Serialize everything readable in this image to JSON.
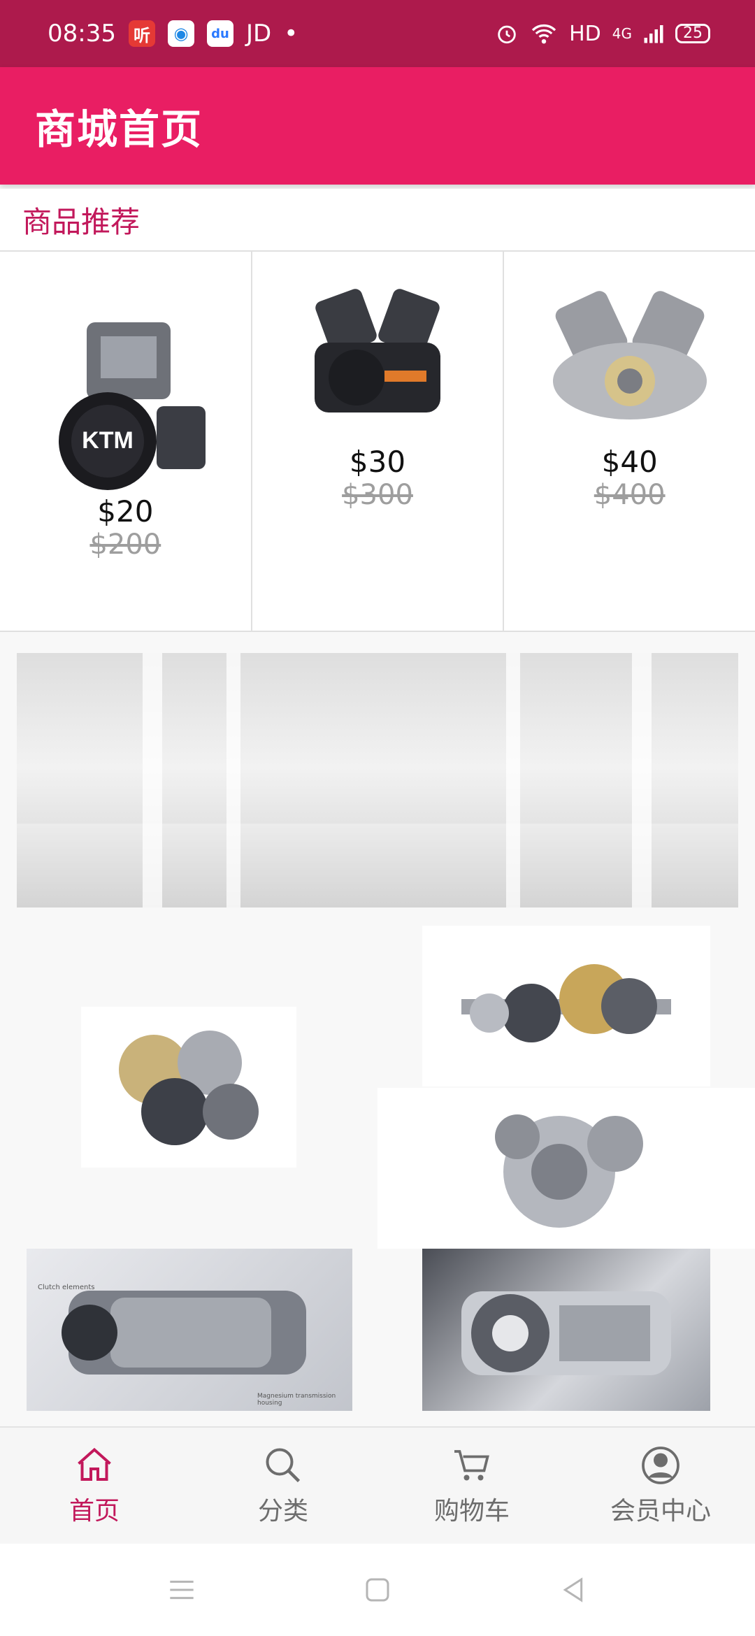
{
  "status_bar": {
    "time": "08:35",
    "app_icons": [
      {
        "icon": "ting-app-icon",
        "glyph": "听",
        "color": "#e53935"
      },
      {
        "icon": "browser-app-icon",
        "glyph": "◉",
        "color": "#1e88e5"
      },
      {
        "icon": "baidu-app-icon",
        "glyph": "du",
        "color": "#2979ff"
      }
    ],
    "jd_label": "JD",
    "dot": "•",
    "network": "HD",
    "signal_type": "4G",
    "battery": "25"
  },
  "app_bar": {
    "title": "商城首页"
  },
  "section": {
    "title": "商品推荐"
  },
  "products": [
    {
      "image_icon": "ktm-engine-image",
      "price": "$20",
      "original_price": "$200"
    },
    {
      "image_icon": "v-twin-engine-image",
      "price": "$30",
      "original_price": "$300"
    },
    {
      "image_icon": "cutaway-engine-image",
      "price": "$40",
      "original_price": "$400"
    }
  ],
  "banner": {
    "image_icon": "factory-floor-image"
  },
  "gallery": [
    {
      "name": "gearbox-image-1",
      "image_icon": "gear-shaft-image"
    },
    {
      "name": "gearbox-image-2",
      "image_icon": "gear-cluster-image"
    },
    {
      "name": "gearbox-image-3",
      "image_icon": "gear-set-image"
    },
    {
      "name": "transmission-image-1",
      "image_icon": "transmission-labeled-image",
      "labels": [
        "Clutch elements",
        "Magnesium transmission housing"
      ]
    },
    {
      "name": "transmission-image-2",
      "image_icon": "transmission-cutaway-image"
    }
  ],
  "bottom_nav": [
    {
      "label": "首页",
      "icon": "home-icon",
      "active": true
    },
    {
      "label": "分类",
      "icon": "search-icon",
      "active": false
    },
    {
      "label": "购物车",
      "icon": "cart-icon",
      "active": false
    },
    {
      "label": "会员中心",
      "icon": "user-icon",
      "active": false
    }
  ],
  "colors": {
    "status_bar": "#ad1a4c",
    "app_bar": "#e91e63",
    "accent": "#c2185b",
    "strike_price": "#9e9e9e"
  }
}
